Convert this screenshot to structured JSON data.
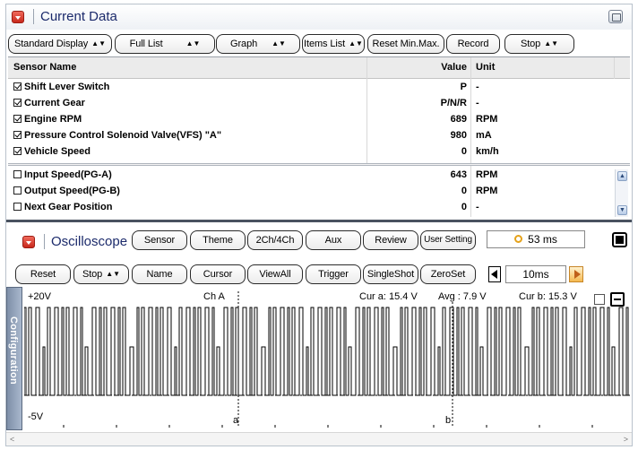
{
  "current_data": {
    "title": "Current Data",
    "toolbar": {
      "standard_display": "Standard Display",
      "full_list": "Full List",
      "graph": "Graph",
      "items_list": "Items List",
      "reset_min_max": "Reset Min.Max.",
      "record": "Record",
      "stop": "Stop"
    },
    "table": {
      "headers": {
        "name": "Sensor Name",
        "value": "Value",
        "unit": "Unit"
      },
      "selected_rows": [
        {
          "name": "Shift Lever Switch",
          "value": "P",
          "unit": "-",
          "checked": true
        },
        {
          "name": "Current Gear",
          "value": "P/N/R",
          "unit": "-",
          "checked": true
        },
        {
          "name": "Engine RPM",
          "value": "689",
          "unit": "RPM",
          "checked": true
        },
        {
          "name": "Pressure Control Solenoid Valve(VFS) \"A\"",
          "value": "980",
          "unit": "mA",
          "checked": true
        },
        {
          "name": "Vehicle Speed",
          "value": "0",
          "unit": "km/h",
          "checked": true
        }
      ],
      "other_rows": [
        {
          "name": "Input Speed(PG-A)",
          "value": "643",
          "unit": "RPM",
          "checked": false
        },
        {
          "name": "Output Speed(PG-B)",
          "value": "0",
          "unit": "RPM",
          "checked": false
        },
        {
          "name": "Next Gear Position",
          "value": "0",
          "unit": "-",
          "checked": false
        }
      ]
    }
  },
  "oscilloscope": {
    "title": "Oscilloscope",
    "top_buttons": {
      "sensor": "Sensor",
      "theme": "Theme",
      "channels": "2Ch/4Ch",
      "aux": "Aux",
      "review": "Review",
      "user_setting": "User Setting"
    },
    "time_readout": "53 ms",
    "bottom_buttons": {
      "reset": "Reset",
      "stop": "Stop",
      "name": "Name",
      "cursor": "Cursor",
      "view_all": "ViewAll",
      "trigger": "Trigger",
      "single_shot": "SingleShot",
      "zero_set": "ZeroSet"
    },
    "timebase": "10ms",
    "side_tab": "Configuration",
    "display": {
      "y_max": "+20V",
      "y_min": "-5V",
      "channel": "Ch A",
      "cursor_a_readout": "Cur a: 15.4 V",
      "avg_readout": "Avg : 7.9 V",
      "cursor_b_readout": "Cur b: 15.3 V",
      "cursor_a_label": "a",
      "cursor_b_label": "b"
    }
  },
  "colors": {
    "accent_title": "#1b2a6b",
    "red_button": "#d0362a",
    "trace": "#000000",
    "config_tab": "#8a9bb4"
  },
  "icons": {
    "collapse": "chevron-down-icon",
    "maximize": "window-maximize-icon",
    "clock": "timer-icon",
    "stop": "stop-square-icon",
    "prev": "triangle-left-icon",
    "next": "triangle-right-icon"
  }
}
